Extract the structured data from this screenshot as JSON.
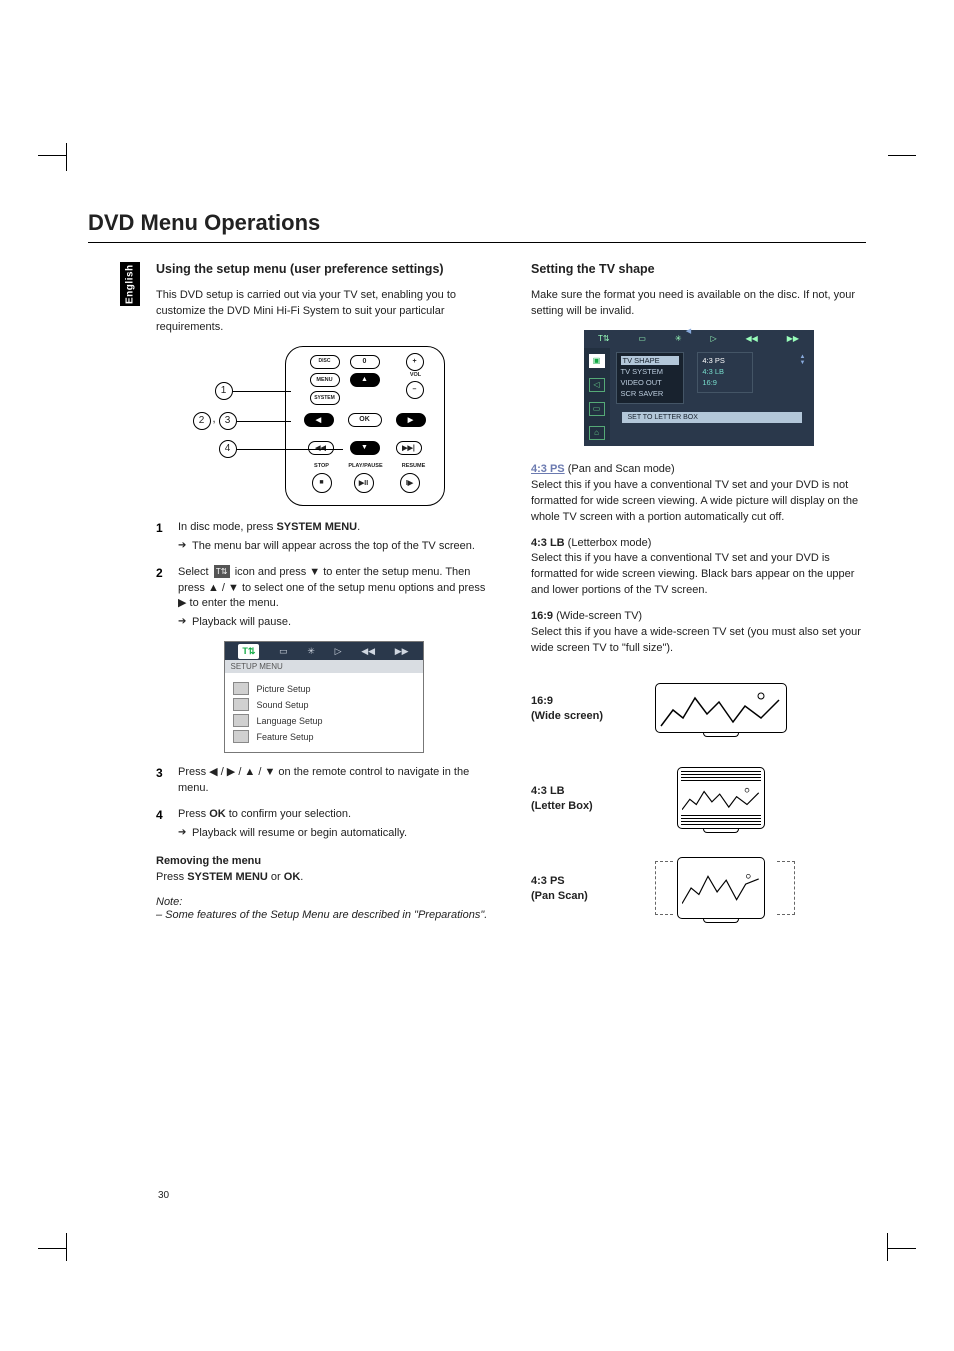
{
  "page": {
    "title": "DVD Menu Operations",
    "language_tab": "English",
    "number": "30"
  },
  "left": {
    "heading": "Using the setup menu (user preference settings)",
    "intro": "This DVD setup is carried out via your TV set, enabling you to customize the DVD Mini Hi-Fi System to suit your particular requirements.",
    "remote": {
      "callouts": {
        "c1": "1",
        "c2": "2",
        "c3": "3",
        "c4": "4"
      },
      "labels": {
        "disc": "DISC",
        "menu": "MENU",
        "system": "SYSTEM",
        "zero": "0",
        "vol": "VOL",
        "ok": "OK",
        "stop": "STOP",
        "playpause": "PLAY/PAUSE",
        "resume": "RESUME"
      }
    },
    "steps": {
      "s1": {
        "num": "1",
        "t1": "In disc mode, press ",
        "b1": "SYSTEM MENU",
        "t2": ".",
        "r1": "The menu bar will appear across the top of the TV screen."
      },
      "s2": {
        "num": "2",
        "t1": "Select ",
        "t2": " icon and press ▼ to enter the setup menu. Then press ▲ / ▼  to select one of the setup menu options and press ▶ to enter the menu.",
        "r1": "Playback will pause."
      },
      "s3": {
        "num": "3",
        "t1": "Press ◀ / ▶ / ▲ / ▼ on the remote control to navigate in the menu."
      },
      "s4": {
        "num": "4",
        "t1": "Press ",
        "b1": "OK",
        "t2": " to confirm your selection.",
        "r1": "Playback will resume or begin automatically."
      }
    },
    "osd": {
      "tabs": {
        "t1": "T⇅",
        "t2": "▭",
        "t3": "✳",
        "t4": "▷",
        "t5": "◀◀",
        "t6": "▶▶"
      },
      "sublabel": "SETUP MENU",
      "items": {
        "i1": "Picture Setup",
        "i2": "Sound Setup",
        "i3": "Language Setup",
        "i4": "Feature Setup"
      }
    },
    "removing": {
      "head": "Removing the menu",
      "t1": "Press ",
      "b1": "SYSTEM MENU",
      "t2": " or ",
      "b2": "OK",
      "t3": "."
    },
    "note": {
      "label": "Note:",
      "body": "– Some features of the Setup Menu are described in \"Preparations\"."
    }
  },
  "right": {
    "heading": "Setting the TV shape",
    "intro": "Make sure the format you need is available on the disc. If not, your setting will be invalid.",
    "osd2": {
      "menu": {
        "m1": "TV SHAPE",
        "m2": "TV SYSTEM",
        "m3": "VIDEO OUT",
        "m4": "SCR SAVER"
      },
      "vals": {
        "v1": "4:3 PS",
        "v2": "4:3 LB",
        "v3": "16:9"
      },
      "footer": "SET TO LETTER BOX"
    },
    "modes": {
      "ps": {
        "link": "4:3 PS",
        "paren": " (Pan and Scan mode)",
        "body": "Select this if you have a conventional TV set and your DVD is not formatted for wide screen viewing. A wide picture will display on the whole TV screen with a portion automatically cut off."
      },
      "lb": {
        "head": "4:3 LB",
        "paren": " (Letterbox mode)",
        "body": "Select this if you have a conventional TV set and your DVD is formatted for wide screen viewing. Black bars appear on the upper and lower portions of the TV screen."
      },
      "ws": {
        "head": "16:9",
        "paren": " (Wide-screen TV)",
        "body": "Select this if you have a wide-screen TV set (you must also set your wide screen TV to \"full size\")."
      }
    },
    "aspects": {
      "a1": {
        "l1": "16:9",
        "l2": "(Wide screen)"
      },
      "a2": {
        "l1": "4:3 LB",
        "l2": "(Letter Box)"
      },
      "a3": {
        "l1": "4:3 PS",
        "l2": "(Pan Scan)"
      }
    }
  }
}
